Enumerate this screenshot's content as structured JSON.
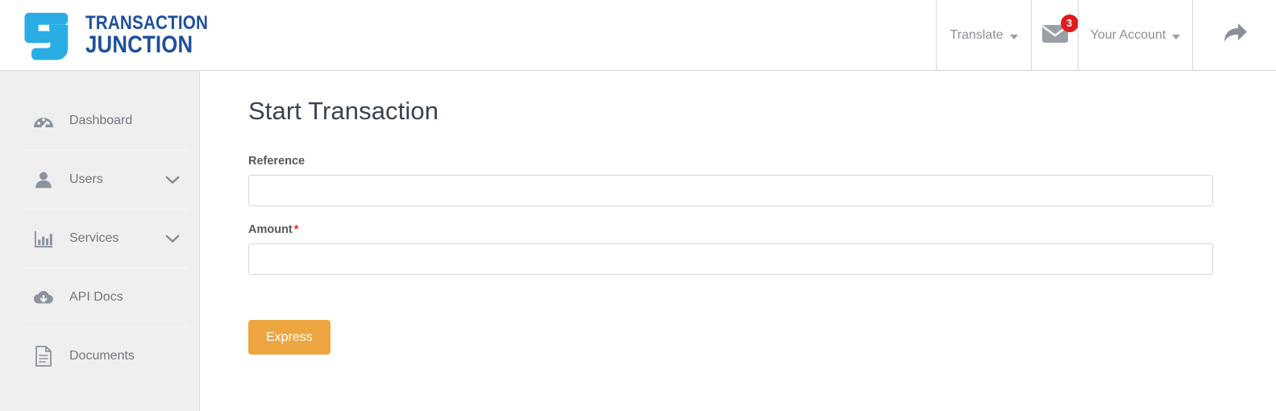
{
  "brand": {
    "logo_icon": "tj-monogram-logo",
    "line1": "TRANSACTION",
    "line2": "JUNCTION",
    "color_primary": "#1e4f9c",
    "color_mark": "#29ade4"
  },
  "header": {
    "nav": {
      "translate_label": "Translate",
      "translate_icon": "chevron-down-icon",
      "mail_icon": "envelope-icon",
      "mail_badge_count": "3",
      "mail_badge_color": "#e01b1b",
      "account_label": "Your Account",
      "account_icon": "chevron-down-icon",
      "logout_icon": "forward-arrow-icon"
    }
  },
  "sidebar": {
    "items": [
      {
        "label": "Dashboard",
        "icon": "speedometer-icon",
        "has_chevron": false
      },
      {
        "label": "Users",
        "icon": "user-icon",
        "has_chevron": true
      },
      {
        "label": "Services",
        "icon": "bar-chart-icon",
        "has_chevron": true
      },
      {
        "label": "API Docs",
        "icon": "cloud-download-icon",
        "has_chevron": false
      },
      {
        "label": "Documents",
        "icon": "document-icon",
        "has_chevron": false
      }
    ]
  },
  "main": {
    "page_title": "Start Transaction",
    "fields": [
      {
        "label": "Reference",
        "required": false,
        "value": "",
        "placeholder": ""
      },
      {
        "label": "Amount",
        "required": true,
        "required_marker": "*",
        "value": "",
        "placeholder": ""
      }
    ],
    "submit_label": "Express",
    "submit_color": "#eda63f"
  }
}
